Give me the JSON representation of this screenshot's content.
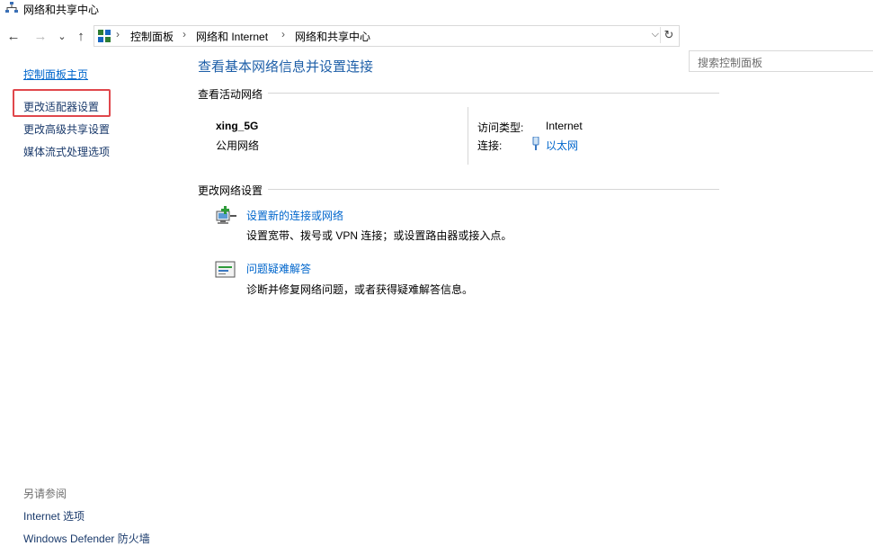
{
  "window": {
    "title": "网络和共享中心",
    "icon": "network-center-icon"
  },
  "nav": {
    "back": "←",
    "forward": "→",
    "recent": "⌄",
    "up": "↑",
    "breadcrumb": [
      "控制面板",
      "网络和 Internet",
      "网络和共享中心"
    ],
    "separator": "›",
    "dropdown": "⌵",
    "refresh": "↻",
    "search_placeholder": "搜索控制面板"
  },
  "sidebar": {
    "home": "控制面板主页",
    "items": [
      "更改适配器设置",
      "更改高级共享设置",
      "媒体流式处理选项"
    ],
    "see_also_title": "另请参阅",
    "see_also": [
      "Internet 选项",
      "Windows Defender 防火墙"
    ]
  },
  "main": {
    "title": "查看基本网络信息并设置连接",
    "active_section": "查看活动网络",
    "network": {
      "name": "xing_5G",
      "type": "公用网络",
      "access_label": "访问类型:",
      "access_value": "Internet",
      "connection_label": "连接:",
      "connection_value": "以太网"
    },
    "change_section": "更改网络设置",
    "tasks": [
      {
        "link": "设置新的连接或网络",
        "desc": "设置宽带、拨号或 VPN 连接；或设置路由器或接入点。",
        "icon": "new-connection-icon"
      },
      {
        "link": "问题疑难解答",
        "desc": "诊断并修复网络问题，或者获得疑难解答信息。",
        "icon": "troubleshoot-icon"
      }
    ]
  },
  "colors": {
    "link": "#0066cc",
    "title": "#1e5fa8",
    "highlight": "#e0474c"
  }
}
